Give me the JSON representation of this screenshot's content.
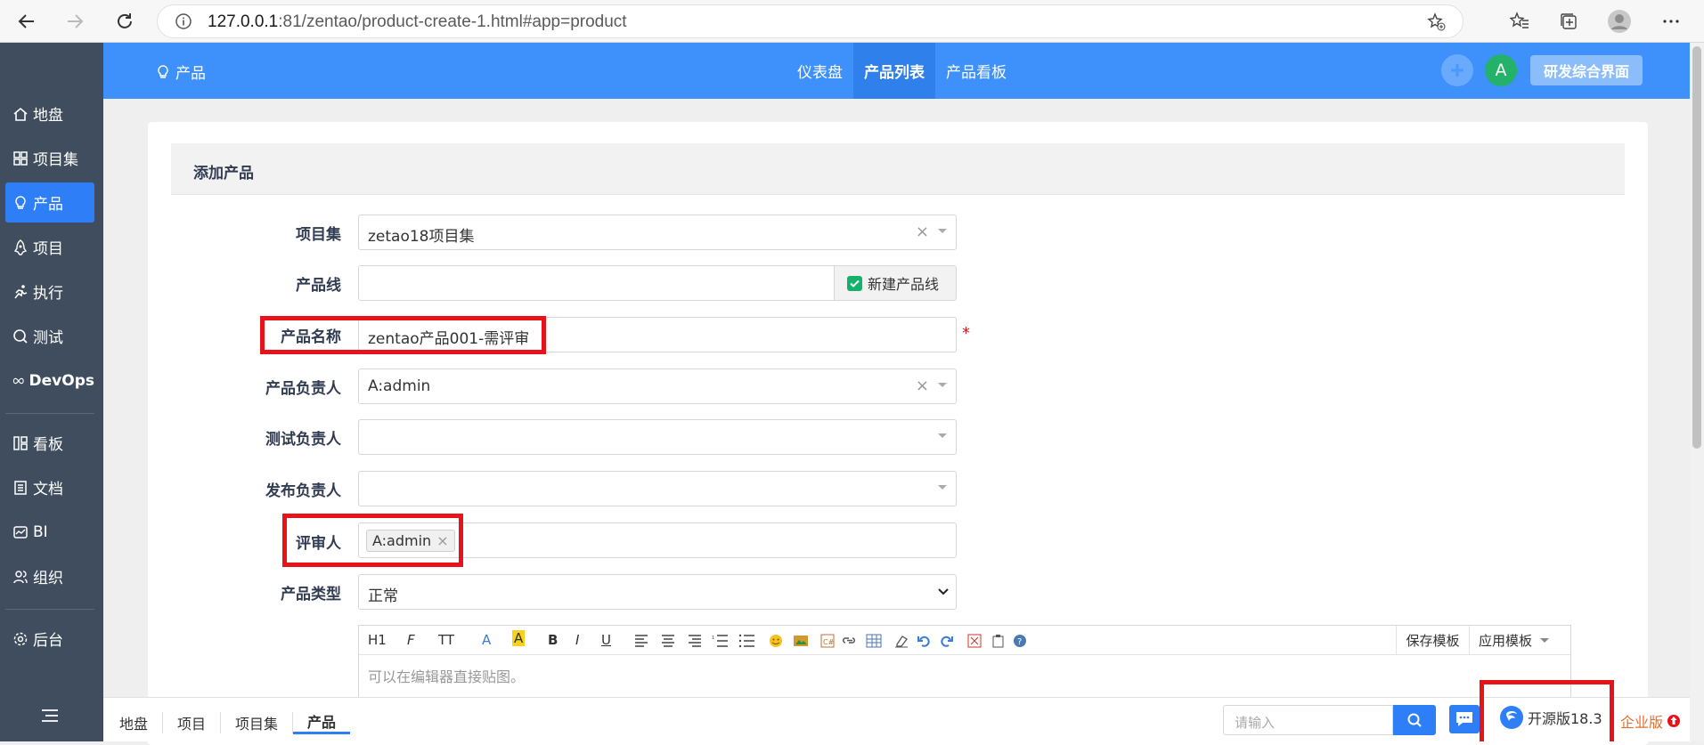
{
  "browser": {
    "url_host": "127.0.0.1",
    "url_path": ":81/zentao/product-create-1.html#app=product"
  },
  "sidebar": {
    "items": [
      {
        "label": "地盘",
        "icon": "home-icon"
      },
      {
        "label": "项目集",
        "icon": "grid-icon"
      },
      {
        "label": "产品",
        "icon": "bulb-icon",
        "active": true
      },
      {
        "label": "项目",
        "icon": "project-icon"
      },
      {
        "label": "执行",
        "icon": "run-icon"
      },
      {
        "label": "测试",
        "icon": "test-icon"
      },
      {
        "label": "DevOps",
        "icon": "infinity-icon"
      },
      {
        "label": "看板",
        "icon": "kanban-icon"
      },
      {
        "label": "文档",
        "icon": "doc-icon"
      },
      {
        "label": "BI",
        "icon": "bi-icon"
      },
      {
        "label": "组织",
        "icon": "people-icon"
      },
      {
        "label": "后台",
        "icon": "gear-icon"
      }
    ],
    "menu_icon": "menu-icon"
  },
  "topbar": {
    "module": "产品",
    "tabs": [
      {
        "label": "仪表盘"
      },
      {
        "label": "产品列表",
        "active": true
      },
      {
        "label": "产品看板"
      }
    ],
    "avatar_letter": "A",
    "switch_button": "研发综合界面"
  },
  "form": {
    "title": "添加产品",
    "fields": {
      "program": {
        "label": "项目集",
        "value": "zetao18项目集"
      },
      "line": {
        "label": "产品线",
        "value": "",
        "new_line_label": "新建产品线"
      },
      "name": {
        "label": "产品名称",
        "value": "zentao产品001-需评审",
        "required_mark": "*"
      },
      "po": {
        "label": "产品负责人",
        "value": "A:admin"
      },
      "qd": {
        "label": "测试负责人",
        "value": ""
      },
      "rd": {
        "label": "发布负责人",
        "value": ""
      },
      "reviewer": {
        "label": "评审人",
        "tag": "A:admin"
      },
      "type": {
        "label": "产品类型",
        "value": "正常"
      }
    },
    "editor": {
      "toolbar": [
        "H1",
        "F",
        "TT",
        "A",
        "A",
        "B",
        "I",
        "U"
      ],
      "save_template": "保存模板",
      "apply_template": "应用模板",
      "placeholder": "可以在编辑器直接贴图。"
    }
  },
  "footer": {
    "breadcrumbs": [
      "地盘",
      "项目",
      "项目集",
      "产品"
    ],
    "search_placeholder": "请输入",
    "version": "开源版18.3",
    "enterprise": "企业版"
  },
  "colors": {
    "primary": "#3e91fb",
    "sidebar": "#3f4d5e",
    "active_side": "#2e7ef8",
    "highlight": "#e8131a"
  }
}
